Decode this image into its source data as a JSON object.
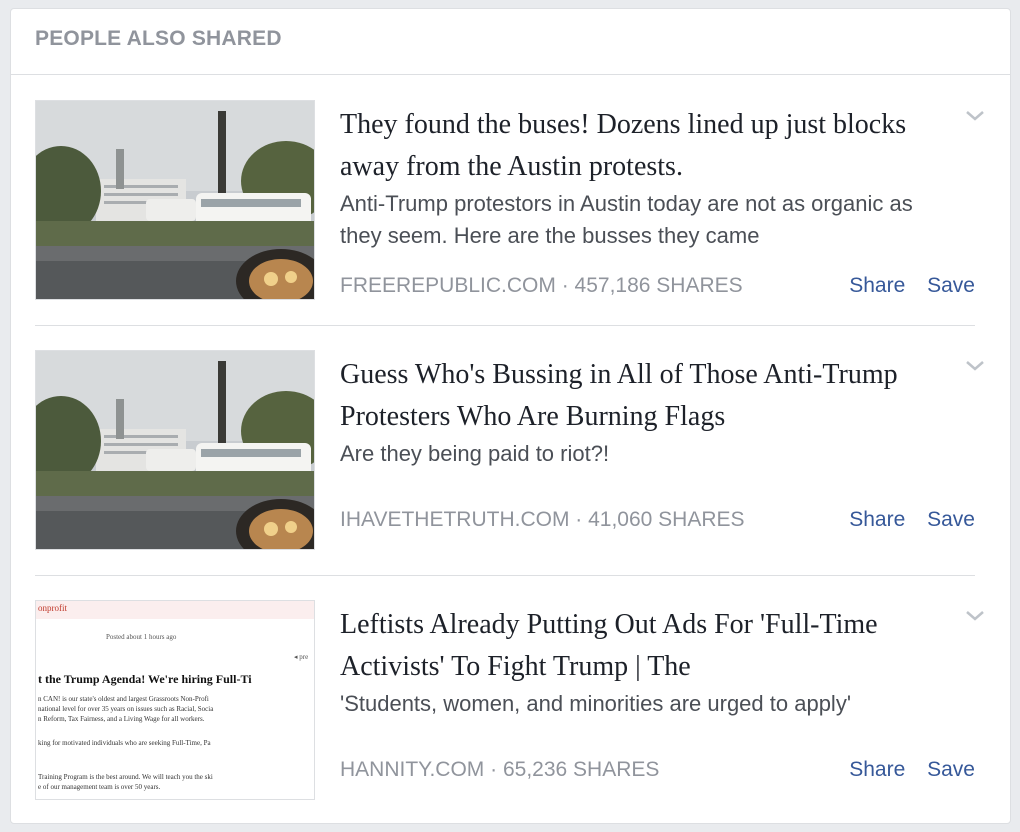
{
  "panel": {
    "title": "PEOPLE ALSO SHARED"
  },
  "items": [
    {
      "headline": "They found the buses! Dozens lined up just blocks away from the Austin protests.",
      "description": "Anti-Trump protestors in Austin today are not as organic as they seem. Here are the busses they came",
      "source": "FREEREPUBLIC.COM · 457,186 SHARES",
      "share_label": "Share",
      "save_label": "Save"
    },
    {
      "headline": "Guess Who's Bussing in All of Those Anti-Trump Protesters Who Are Burning Flags",
      "description": "Are they being paid to riot?!",
      "source": "IHAVETHETRUTH.COM · 41,060 SHARES",
      "share_label": "Share",
      "save_label": "Save"
    },
    {
      "headline": "Leftists Already Putting Out Ads For 'Full-Time Activists' To Fight Trump | The",
      "description": "'Students, women, and minorities are urged to apply'",
      "source": "HANNITY.COM · 65,236 SHARES",
      "share_label": "Share",
      "save_label": "Save",
      "thumb_text": {
        "tag": "onprofit",
        "posted": "Posted about 1 hours ago",
        "heading": "t the Trump Agenda! We're hiring Full-Ti",
        "line1": "n CAN! is our state's oldest and largest Grassroots Non-Profi",
        "line2": "national level for over 35 years on issues such as Racial, Socia",
        "line3": "n Reform, Tax Fairness, and a Living Wage for all workers.",
        "line4": "king for motivated individuals who are seeking Full-Time, Pa",
        "line5": "Training Program is the best around. We will teach you the ski",
        "line6": "e of our management team is over 50 years."
      }
    }
  ],
  "colors": {
    "link": "#365899",
    "muted": "#90949c",
    "text": "#1d2129",
    "border": "#dddfe2"
  },
  "icons": {
    "menu": "chevron-down-icon"
  }
}
